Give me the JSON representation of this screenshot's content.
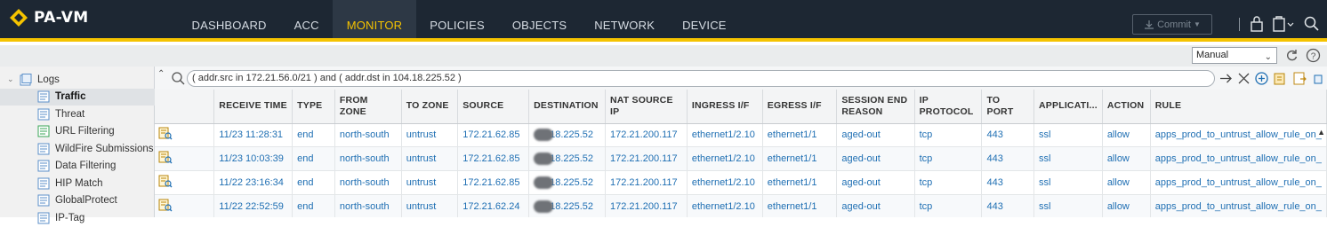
{
  "app": {
    "name": "PA-VM"
  },
  "nav": {
    "tabs": [
      "DASHBOARD",
      "ACC",
      "MONITOR",
      "POLICIES",
      "OBJECTS",
      "NETWORK",
      "DEVICE"
    ],
    "active": "MONITOR"
  },
  "toolbar": {
    "commit_label": "Commit"
  },
  "refresh": {
    "selected": "Manual"
  },
  "sidebar": {
    "group_label": "Logs",
    "items": [
      {
        "label": "Traffic",
        "selected": true
      },
      {
        "label": "Threat"
      },
      {
        "label": "URL Filtering"
      },
      {
        "label": "WildFire Submissions"
      },
      {
        "label": "Data Filtering"
      },
      {
        "label": "HIP Match"
      },
      {
        "label": "GlobalProtect"
      },
      {
        "label": "IP-Tag"
      }
    ]
  },
  "filter": {
    "query": "( addr.src in 172.21.56.0/21 ) and ( addr.dst in 104.18.225.52 )"
  },
  "table": {
    "columns": [
      "",
      "RECEIVE TIME",
      "TYPE",
      "FROM ZONE",
      "TO ZONE",
      "SOURCE",
      "DESTINATION",
      "NAT SOURCE IP",
      "INGRESS I/F",
      "EGRESS I/F",
      "SESSION END REASON",
      "IP PROTOCOL",
      "TO PORT",
      "APPLICATI...",
      "ACTION",
      "RULE"
    ],
    "rows": [
      {
        "receive_time": "11/23 11:28:31",
        "type": "end",
        "from_zone": "north-south",
        "to_zone": "untrust",
        "source": "172.21.62.85",
        "destination": "18.225.52",
        "nat_source_ip": "172.21.200.117",
        "ingress": "ethernet1/2.10",
        "egress": "ethernet1/1",
        "end_reason": "aged-out",
        "protocol": "tcp",
        "to_port": "443",
        "application": "ssl",
        "action": "allow",
        "rule": "apps_prod_to_untrust_allow_rule_on_"
      },
      {
        "receive_time": "11/23 10:03:39",
        "type": "end",
        "from_zone": "north-south",
        "to_zone": "untrust",
        "source": "172.21.62.85",
        "destination": "18.225.52",
        "nat_source_ip": "172.21.200.117",
        "ingress": "ethernet1/2.10",
        "egress": "ethernet1/1",
        "end_reason": "aged-out",
        "protocol": "tcp",
        "to_port": "443",
        "application": "ssl",
        "action": "allow",
        "rule": "apps_prod_to_untrust_allow_rule_on_"
      },
      {
        "receive_time": "11/22 23:16:34",
        "type": "end",
        "from_zone": "north-south",
        "to_zone": "untrust",
        "source": "172.21.62.85",
        "destination": "18.225.52",
        "nat_source_ip": "172.21.200.117",
        "ingress": "ethernet1/2.10",
        "egress": "ethernet1/1",
        "end_reason": "aged-out",
        "protocol": "tcp",
        "to_port": "443",
        "application": "ssl",
        "action": "allow",
        "rule": "apps_prod_to_untrust_allow_rule_on_"
      },
      {
        "receive_time": "11/22 22:52:59",
        "type": "end",
        "from_zone": "north-south",
        "to_zone": "untrust",
        "source": "172.21.62.24",
        "destination": "18.225.52",
        "nat_source_ip": "172.21.200.117",
        "ingress": "ethernet1/2.10",
        "egress": "ethernet1/1",
        "end_reason": "aged-out",
        "protocol": "tcp",
        "to_port": "443",
        "application": "ssl",
        "action": "allow",
        "rule": "apps_prod_to_untrust_allow_rule_on_"
      }
    ]
  },
  "colors": {
    "header_bg": "#1d2733",
    "accent": "#f5c300",
    "link": "#1f6fb3"
  },
  "icons": [
    "logo-mark-icon",
    "commit-icon",
    "lock-icon",
    "config-icon",
    "search-icon",
    "refresh-icon",
    "help-icon",
    "clear-icon",
    "add-icon",
    "export-icon",
    "save-icon",
    "detail-view-icon"
  ]
}
